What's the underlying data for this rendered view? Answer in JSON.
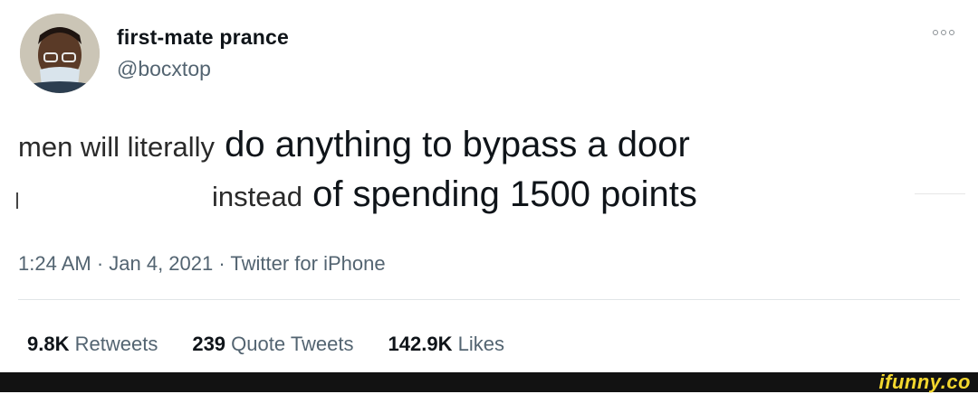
{
  "tweet": {
    "author": {
      "display_name": "first-mate prance",
      "handle": "@bocxtop"
    },
    "text": {
      "line1_small": "men will literally",
      "line1_large": " do anything to bypass a door",
      "line2_small": "instead",
      "line2_large": " of spending 1500 points"
    },
    "meta": "1:24 AM · Jan 4, 2021 · Twitter for iPhone",
    "stats": [
      {
        "value": "9.8K",
        "label": "Retweets"
      },
      {
        "value": "239",
        "label": "Quote Tweets"
      },
      {
        "value": "142.9K",
        "label": "Likes"
      }
    ]
  },
  "icons": {
    "more": "more-options-icon"
  },
  "watermark": "ifunny.co",
  "colors": {
    "text": "#0f1419",
    "secondary": "#536471",
    "watermark": "#f3d72e",
    "footer": "#121212"
  }
}
